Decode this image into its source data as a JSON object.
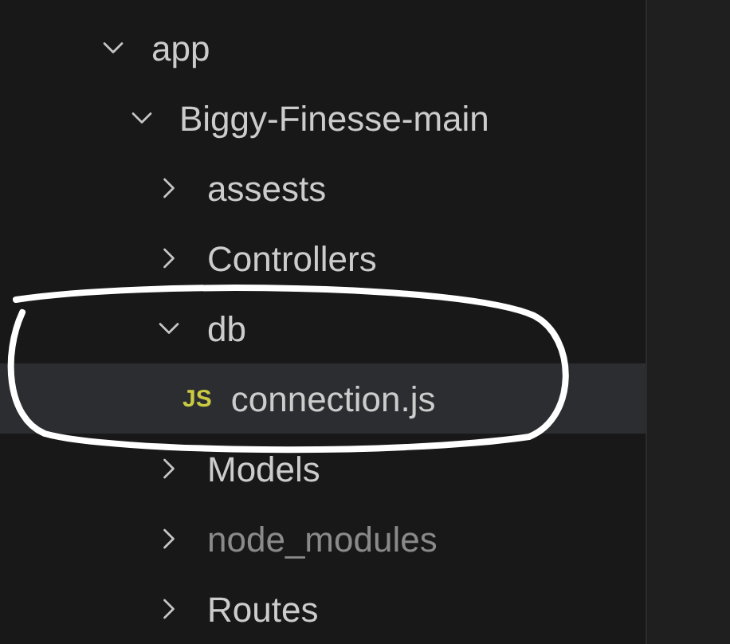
{
  "tree": [
    {
      "name": "app",
      "kind": "folder",
      "expanded": true,
      "selected": false,
      "ignored": false,
      "children": [
        {
          "name": "Biggy-Finesse-main",
          "kind": "folder",
          "expanded": true,
          "selected": false,
          "ignored": false,
          "children": [
            {
              "name": "assests",
              "kind": "folder",
              "expanded": false,
              "selected": false,
              "ignored": false
            },
            {
              "name": "Controllers",
              "kind": "folder",
              "expanded": false,
              "selected": false,
              "ignored": false
            },
            {
              "name": "db",
              "kind": "folder",
              "expanded": true,
              "selected": false,
              "ignored": false,
              "children": [
                {
                  "name": "connection.js",
                  "kind": "file",
                  "icon_label": "JS",
                  "selected": true,
                  "ignored": false
                }
              ]
            },
            {
              "name": "Models",
              "kind": "folder",
              "expanded": false,
              "selected": false,
              "ignored": false
            },
            {
              "name": "node_modules",
              "kind": "folder",
              "expanded": false,
              "selected": false,
              "ignored": true
            },
            {
              "name": "Routes",
              "kind": "folder",
              "expanded": false,
              "selected": false,
              "ignored": false
            }
          ]
        }
      ]
    }
  ],
  "annotation": {
    "kind": "circle"
  }
}
